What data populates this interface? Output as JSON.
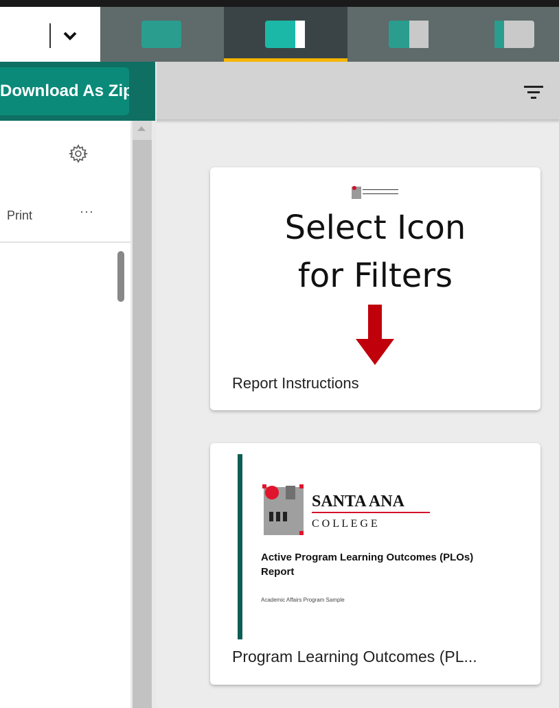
{
  "topbar": {
    "tabs": [
      {
        "icon": "slide-icon-full",
        "active": false
      },
      {
        "icon": "slide-icon-split",
        "active": true
      },
      {
        "icon": "slide-icon-half",
        "active": false
      },
      {
        "icon": "slide-icon-half-right",
        "active": false
      }
    ],
    "accent_color": "#f5b400"
  },
  "left_panel": {
    "download_button": "Download As Zip",
    "print_label": "Print",
    "more_label": "···"
  },
  "right_panel": {
    "filter_icon": "filter-icon",
    "cards": [
      {
        "logo_text": "SANTA ANA COLLEGE",
        "thumbnail_line1": "Select Icon",
        "thumbnail_line2": "for Filters",
        "title": "Report Instructions"
      },
      {
        "logo_name": "SANTA ANA",
        "logo_sub": "C O L L E G E",
        "report_title": "Active Program Learning Outcomes (PLOs) Report",
        "report_subtitle": "Academic Affairs Program Sample",
        "title": "Program Learning Outcomes (PL..."
      }
    ]
  },
  "colors": {
    "teal_button": "#0b8a79",
    "arrow_red": "#c0000b",
    "tab_teal": "#1aa89a"
  }
}
